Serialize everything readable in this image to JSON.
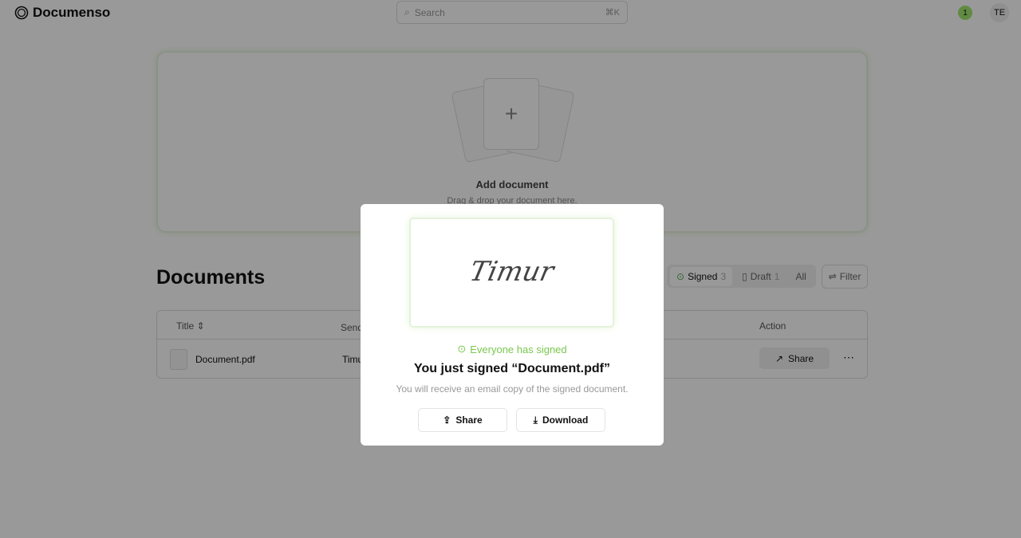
{
  "header": {
    "brand": "Documenso",
    "search_placeholder": "Search",
    "search_shortcut": "⌘K",
    "notification_count": "1",
    "avatar_initials": "TE"
  },
  "dropzone": {
    "title": "Add document",
    "subtitle": "Drag & drop your document here."
  },
  "documents": {
    "title": "Documents",
    "tabs": [
      {
        "label": "Signed",
        "count": "3",
        "active": true
      },
      {
        "label": "Draft",
        "count": "1"
      },
      {
        "label": "All"
      }
    ],
    "filter_label": "Filter",
    "columns": [
      "Title",
      "Sender",
      "Action"
    ],
    "rows": [
      {
        "title": "Document.pdf",
        "sender": "Timur",
        "action": "Share"
      }
    ]
  },
  "modal": {
    "signature": "Timur",
    "status": "Everyone has signed",
    "title": "You just signed “Document.pdf”",
    "subtitle": "You will receive an email copy of the signed document.",
    "share_label": "Share",
    "download_label": "Download",
    "accent": "#7ac74f"
  }
}
